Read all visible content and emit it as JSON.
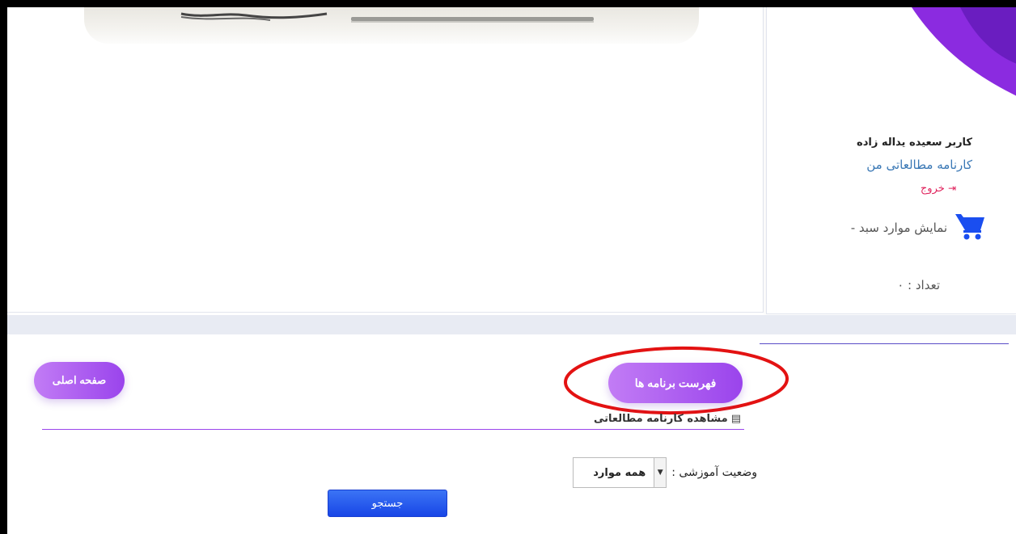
{
  "user_panel": {
    "user_name": "کاربر سعیده یداله زاده",
    "study_report_link": "کارنامه مطالعاتی من",
    "logout_label": "خروج",
    "cart_label": "نمایش موارد سبد -",
    "cart_count": "تعداد : ۰"
  },
  "actions": {
    "programs_button": "فهرست برنامه ها",
    "home_button": "صفحه اصلی"
  },
  "report_section": {
    "heading": "مشاهده کارنامه مطالعاتی"
  },
  "filter": {
    "status_label": "وضعیت آموزشی :",
    "status_selected": "همه موارد",
    "search_button": "جستجو"
  },
  "icons": {
    "logout": "logout-icon",
    "cart": "cart-icon",
    "report": "report-icon",
    "dropdown": "chevron-down-icon"
  },
  "colors": {
    "accent_purple": "#9a44ec",
    "cart_blue": "#1a4ef0",
    "logout_red": "#e0245e",
    "highlight_red": "#e31212",
    "search_blue": "#1846e6"
  }
}
